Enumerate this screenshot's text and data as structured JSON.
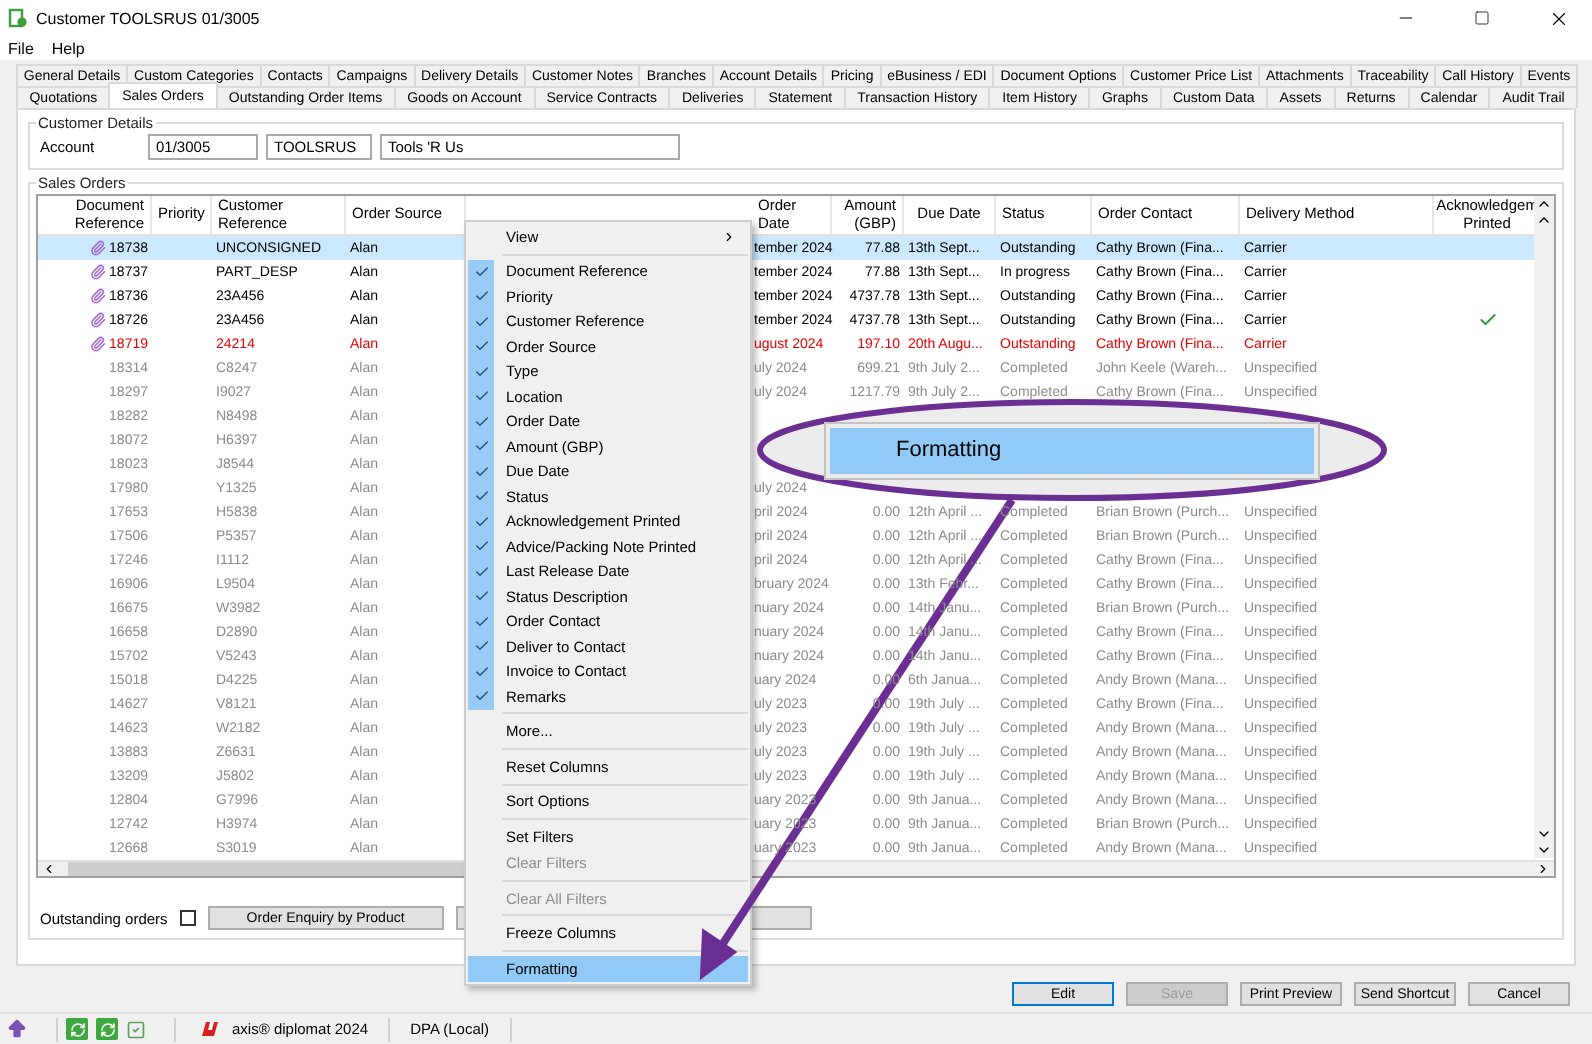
{
  "window": {
    "title": "Customer TOOLSRUS 01/3005"
  },
  "menu_bar": [
    "File",
    "Help"
  ],
  "tab_rows": [
    [
      {
        "label": "General Details",
        "selected": false
      },
      {
        "label": "Custom Categories",
        "selected": false
      },
      {
        "label": "Contacts",
        "selected": false
      },
      {
        "label": "Campaigns",
        "selected": false
      },
      {
        "label": "Delivery Details",
        "selected": false
      },
      {
        "label": "Customer Notes",
        "selected": false
      },
      {
        "label": "Branches",
        "selected": false
      },
      {
        "label": "Account Details",
        "selected": false
      },
      {
        "label": "Pricing",
        "selected": false
      },
      {
        "label": "eBusiness / EDI",
        "selected": false
      },
      {
        "label": "Document Options",
        "selected": false
      },
      {
        "label": "Customer Price List",
        "selected": false
      },
      {
        "label": "Attachments",
        "selected": false
      },
      {
        "label": "Traceability",
        "selected": false
      },
      {
        "label": "Call History",
        "selected": false
      },
      {
        "label": "Events",
        "selected": false
      }
    ],
    [
      {
        "label": "Quotations",
        "selected": false
      },
      {
        "label": "Sales Orders",
        "selected": true
      },
      {
        "label": "Outstanding Order Items",
        "selected": false
      },
      {
        "label": "Goods on Account",
        "selected": false
      },
      {
        "label": "Service Contracts",
        "selected": false
      },
      {
        "label": "Deliveries",
        "selected": false
      },
      {
        "label": "Statement",
        "selected": false
      },
      {
        "label": "Transaction History",
        "selected": false
      },
      {
        "label": "Item History",
        "selected": false
      },
      {
        "label": "Graphs",
        "selected": false
      },
      {
        "label": "Custom Data",
        "selected": false
      },
      {
        "label": "Assets",
        "selected": false
      },
      {
        "label": "Returns",
        "selected": false
      },
      {
        "label": "Calendar",
        "selected": false
      },
      {
        "label": "Audit Trail",
        "selected": false
      }
    ]
  ],
  "customer_details": {
    "title": "Customer Details",
    "label": "Account",
    "account": "01/3005",
    "code": "TOOLSRUS",
    "name": "Tools 'R Us"
  },
  "sales_orders": {
    "title": "Sales Orders",
    "columns": [
      "Document Reference",
      "Priority",
      "Customer Reference",
      "Order Source",
      "Order Date",
      "Amount (GBP)",
      "Due Date",
      "Status",
      "Order Contact",
      "Delivery Method",
      "Acknowledgem Printed"
    ],
    "rows": [
      {
        "kind": "open",
        "selected": true,
        "attachment": true,
        "acknowledged": false,
        "document_reference": "18738",
        "customer_reference": "UNCONSIGNED",
        "order_source": "Alan",
        "order_date": "tember 2024",
        "amount": "77.88",
        "due_date": "13th Sept...",
        "status": "Outstanding",
        "order_contact": "Cathy Brown (Fina...",
        "delivery_method": "Carrier"
      },
      {
        "kind": "open",
        "selected": false,
        "attachment": true,
        "acknowledged": false,
        "document_reference": "18737",
        "customer_reference": "PART_DESP",
        "order_source": "Alan",
        "order_date": "tember 2024",
        "amount": "77.88",
        "due_date": "13th Sept...",
        "status": "In progress",
        "order_contact": "Cathy Brown (Fina...",
        "delivery_method": "Carrier"
      },
      {
        "kind": "open",
        "selected": false,
        "attachment": true,
        "acknowledged": false,
        "document_reference": "18736",
        "customer_reference": "23A456",
        "order_source": "Alan",
        "order_date": "tember 2024",
        "amount": "4737.78",
        "due_date": "13th Sept...",
        "status": "Outstanding",
        "order_contact": "Cathy Brown (Fina...",
        "delivery_method": "Carrier"
      },
      {
        "kind": "open",
        "selected": false,
        "attachment": true,
        "acknowledged": true,
        "document_reference": "18726",
        "customer_reference": "23A456",
        "order_source": "Alan",
        "order_date": "tember 2024",
        "amount": "4737.78",
        "due_date": "13th Sept...",
        "status": "Outstanding",
        "order_contact": "Cathy Brown (Fina...",
        "delivery_method": "Carrier"
      },
      {
        "kind": "overdue",
        "selected": false,
        "attachment": true,
        "acknowledged": false,
        "document_reference": "18719",
        "customer_reference": "24214",
        "order_source": "Alan",
        "order_date": "ugust 2024",
        "amount": "197.10",
        "due_date": "20th Augu...",
        "status": "Outstanding",
        "order_contact": "Cathy Brown (Fina...",
        "delivery_method": "Carrier"
      },
      {
        "kind": "completed",
        "selected": false,
        "attachment": false,
        "acknowledged": false,
        "document_reference": "18314",
        "customer_reference": "C8247",
        "order_source": "Alan",
        "order_date": "uly 2024",
        "amount": "699.21",
        "due_date": "9th July 2...",
        "status": "Completed",
        "order_contact": "John Keele (Wareh...",
        "delivery_method": "Unspecified"
      },
      {
        "kind": "completed",
        "selected": false,
        "attachment": false,
        "acknowledged": false,
        "document_reference": "18297",
        "customer_reference": "I9027",
        "order_source": "Alan",
        "order_date": "uly 2024",
        "amount": "1217.79",
        "due_date": "9th July 2...",
        "status": "Completed",
        "order_contact": "Cathy Brown (Fina...",
        "delivery_method": "Unspecified"
      },
      {
        "kind": "completed",
        "selected": false,
        "attachment": false,
        "acknowledged": false,
        "document_reference": "18282",
        "customer_reference": "N8498",
        "order_source": "Alan"
      },
      {
        "kind": "completed",
        "selected": false,
        "attachment": false,
        "acknowledged": false,
        "document_reference": "18072",
        "customer_reference": "H6397",
        "order_source": "Alan"
      },
      {
        "kind": "completed",
        "selected": false,
        "attachment": false,
        "acknowledged": false,
        "document_reference": "18023",
        "customer_reference": "J8544",
        "order_source": "Alan"
      },
      {
        "kind": "completed",
        "selected": false,
        "attachment": false,
        "acknowledged": false,
        "document_reference": "17980",
        "customer_reference": "Y1325",
        "order_source": "Alan",
        "order_date": "uly 2024"
      },
      {
        "kind": "completed",
        "selected": false,
        "attachment": false,
        "acknowledged": false,
        "document_reference": "17653",
        "customer_reference": "H5838",
        "order_source": "Alan",
        "order_date": "pril 2024",
        "amount": "0.00",
        "due_date": "12th April ...",
        "status": "Completed",
        "order_contact": "Brian Brown (Purch...",
        "delivery_method": "Unspecified"
      },
      {
        "kind": "completed",
        "selected": false,
        "attachment": false,
        "acknowledged": false,
        "document_reference": "17506",
        "customer_reference": "P5357",
        "order_source": "Alan",
        "order_date": "pril 2024",
        "amount": "0.00",
        "due_date": "12th April ...",
        "status": "Completed",
        "order_contact": "Brian Brown (Purch...",
        "delivery_method": "Unspecified"
      },
      {
        "kind": "completed",
        "selected": false,
        "attachment": false,
        "acknowledged": false,
        "document_reference": "17246",
        "customer_reference": "I1112",
        "order_source": "Alan",
        "order_date": "pril 2024",
        "amount": "0.00",
        "due_date": "12th April ...",
        "status": "Completed",
        "order_contact": "Cathy Brown (Fina...",
        "delivery_method": "Unspecified"
      },
      {
        "kind": "completed",
        "selected": false,
        "attachment": false,
        "acknowledged": false,
        "document_reference": "16906",
        "customer_reference": "L9504",
        "order_source": "Alan",
        "order_date": "bruary 2024",
        "amount": "0.00",
        "due_date": "13th Febr...",
        "status": "Completed",
        "order_contact": "Cathy Brown (Fina...",
        "delivery_method": "Unspecified"
      },
      {
        "kind": "completed",
        "selected": false,
        "attachment": false,
        "acknowledged": false,
        "document_reference": "16675",
        "customer_reference": "W3982",
        "order_source": "Alan",
        "order_date": "nuary 2024",
        "amount": "0.00",
        "due_date": "14th Janu...",
        "status": "Completed",
        "order_contact": "Brian Brown (Purch...",
        "delivery_method": "Unspecified"
      },
      {
        "kind": "completed",
        "selected": false,
        "attachment": false,
        "acknowledged": false,
        "document_reference": "16658",
        "customer_reference": "D2890",
        "order_source": "Alan",
        "order_date": "nuary 2024",
        "amount": "0.00",
        "due_date": "14th Janu...",
        "status": "Completed",
        "order_contact": "Cathy Brown (Fina...",
        "delivery_method": "Unspecified"
      },
      {
        "kind": "completed",
        "selected": false,
        "attachment": false,
        "acknowledged": false,
        "document_reference": "15702",
        "customer_reference": "V5243",
        "order_source": "Alan",
        "order_date": "nuary 2024",
        "amount": "0.00",
        "due_date": "14th Janu...",
        "status": "Completed",
        "order_contact": "Cathy Brown (Fina...",
        "delivery_method": "Unspecified"
      },
      {
        "kind": "completed",
        "selected": false,
        "attachment": false,
        "acknowledged": false,
        "document_reference": "15018",
        "customer_reference": "D4225",
        "order_source": "Alan",
        "order_date": "uary 2024",
        "amount": "0.00",
        "due_date": "6th Janua...",
        "status": "Completed",
        "order_contact": "Andy Brown (Mana...",
        "delivery_method": "Unspecified"
      },
      {
        "kind": "completed",
        "selected": false,
        "attachment": false,
        "acknowledged": false,
        "document_reference": "14627",
        "customer_reference": "V8121",
        "order_source": "Alan",
        "order_date": "uly 2023",
        "amount": "0.00",
        "due_date": "19th July ...",
        "status": "Completed",
        "order_contact": "Cathy Brown (Fina...",
        "delivery_method": "Unspecified"
      },
      {
        "kind": "completed",
        "selected": false,
        "attachment": false,
        "acknowledged": false,
        "document_reference": "14623",
        "customer_reference": "W2182",
        "order_source": "Alan",
        "order_date": "uly 2023",
        "amount": "0.00",
        "due_date": "19th July ...",
        "status": "Completed",
        "order_contact": "Andy Brown (Mana...",
        "delivery_method": "Unspecified"
      },
      {
        "kind": "completed",
        "selected": false,
        "attachment": false,
        "acknowledged": false,
        "document_reference": "13883",
        "customer_reference": "Z6631",
        "order_source": "Alan",
        "order_date": "uly 2023",
        "amount": "0.00",
        "due_date": "19th July ...",
        "status": "Completed",
        "order_contact": "Andy Brown (Mana...",
        "delivery_method": "Unspecified"
      },
      {
        "kind": "completed",
        "selected": false,
        "attachment": false,
        "acknowledged": false,
        "document_reference": "13209",
        "customer_reference": "J5802",
        "order_source": "Alan",
        "order_date": "uly 2023",
        "amount": "0.00",
        "due_date": "19th July ...",
        "status": "Completed",
        "order_contact": "Andy Brown (Mana...",
        "delivery_method": "Unspecified"
      },
      {
        "kind": "completed",
        "selected": false,
        "attachment": false,
        "acknowledged": false,
        "document_reference": "12804",
        "customer_reference": "G7996",
        "order_source": "Alan",
        "order_date": "uary 2023",
        "amount": "0.00",
        "due_date": "9th Janua...",
        "status": "Completed",
        "order_contact": "Andy Brown (Mana...",
        "delivery_method": "Unspecified"
      },
      {
        "kind": "completed",
        "selected": false,
        "attachment": false,
        "acknowledged": false,
        "document_reference": "12742",
        "customer_reference": "H3974",
        "order_source": "Alan",
        "order_date": "uary 2023",
        "amount": "0.00",
        "due_date": "9th Janua...",
        "status": "Completed",
        "order_contact": "Brian Brown (Purch...",
        "delivery_method": "Unspecified"
      },
      {
        "kind": "completed",
        "selected": false,
        "attachment": false,
        "acknowledged": false,
        "document_reference": "12668",
        "customer_reference": "S3019",
        "order_source": "Alan",
        "order_date": "uary 2023",
        "amount": "0.00",
        "due_date": "9th Janua...",
        "status": "Completed",
        "order_contact": "Andy Brown (Mana...",
        "delivery_method": "Unspecified"
      }
    ],
    "outstanding_orders": {
      "label": "Outstanding orders",
      "checked": false
    },
    "buttons": [
      "Order Enquiry by Product"
    ]
  },
  "footer_buttons": [
    {
      "label": "Edit",
      "disabled": false,
      "selected": true
    },
    {
      "label": "Save",
      "disabled": true,
      "selected": false
    },
    {
      "label": "Print Preview",
      "disabled": false,
      "selected": false
    },
    {
      "label": "Send Shortcut",
      "disabled": false,
      "selected": false
    },
    {
      "label": "Cancel",
      "disabled": false,
      "selected": false
    }
  ],
  "status_bar": {
    "product": "axis® diplomat 2024",
    "connection": "DPA (Local)"
  },
  "context_menu": [
    {
      "kind": "submenu",
      "label": "View"
    },
    {
      "kind": "separator"
    },
    {
      "kind": "check",
      "label": "Document Reference",
      "checked": true
    },
    {
      "kind": "check",
      "label": "Priority",
      "checked": true
    },
    {
      "kind": "check",
      "label": "Customer Reference",
      "checked": true
    },
    {
      "kind": "check",
      "label": "Order Source",
      "checked": true
    },
    {
      "kind": "check",
      "label": "Type",
      "checked": true
    },
    {
      "kind": "check",
      "label": "Location",
      "checked": true
    },
    {
      "kind": "check",
      "label": "Order Date",
      "checked": true
    },
    {
      "kind": "check",
      "label": "Amount (GBP)",
      "checked": true
    },
    {
      "kind": "check",
      "label": "Due Date",
      "checked": true
    },
    {
      "kind": "check",
      "label": "Status",
      "checked": true
    },
    {
      "kind": "check",
      "label": "Acknowledgement Printed",
      "checked": true
    },
    {
      "kind": "check",
      "label": "Advice/Packing Note Printed",
      "checked": true
    },
    {
      "kind": "check",
      "label": "Last Release Date",
      "checked": true
    },
    {
      "kind": "check",
      "label": "Status Description",
      "checked": true
    },
    {
      "kind": "check",
      "label": "Order Contact",
      "checked": true
    },
    {
      "kind": "check",
      "label": "Deliver to Contact",
      "checked": true
    },
    {
      "kind": "check",
      "label": "Invoice to Contact",
      "checked": true
    },
    {
      "kind": "check",
      "label": "Remarks",
      "checked": true
    },
    {
      "kind": "separator"
    },
    {
      "kind": "command",
      "label": "More...",
      "disabled": false,
      "selected": false
    },
    {
      "kind": "separator"
    },
    {
      "kind": "command",
      "label": "Reset Columns",
      "disabled": false,
      "selected": false
    },
    {
      "kind": "separator"
    },
    {
      "kind": "command",
      "label": "Sort Options",
      "disabled": false,
      "selected": false
    },
    {
      "kind": "separator"
    },
    {
      "kind": "command",
      "label": "Set Filters",
      "disabled": false,
      "selected": false
    },
    {
      "kind": "command",
      "label": "Clear Filters",
      "disabled": true,
      "selected": false
    },
    {
      "kind": "separator"
    },
    {
      "kind": "command",
      "label": "Clear All Filters",
      "disabled": true,
      "selected": false
    },
    {
      "kind": "separator"
    },
    {
      "kind": "command",
      "label": "Freeze Columns",
      "disabled": false,
      "selected": false
    },
    {
      "kind": "separator"
    },
    {
      "kind": "command",
      "label": "Formatting",
      "disabled": false,
      "selected": true
    }
  ],
  "callout": {
    "label": "Formatting"
  }
}
